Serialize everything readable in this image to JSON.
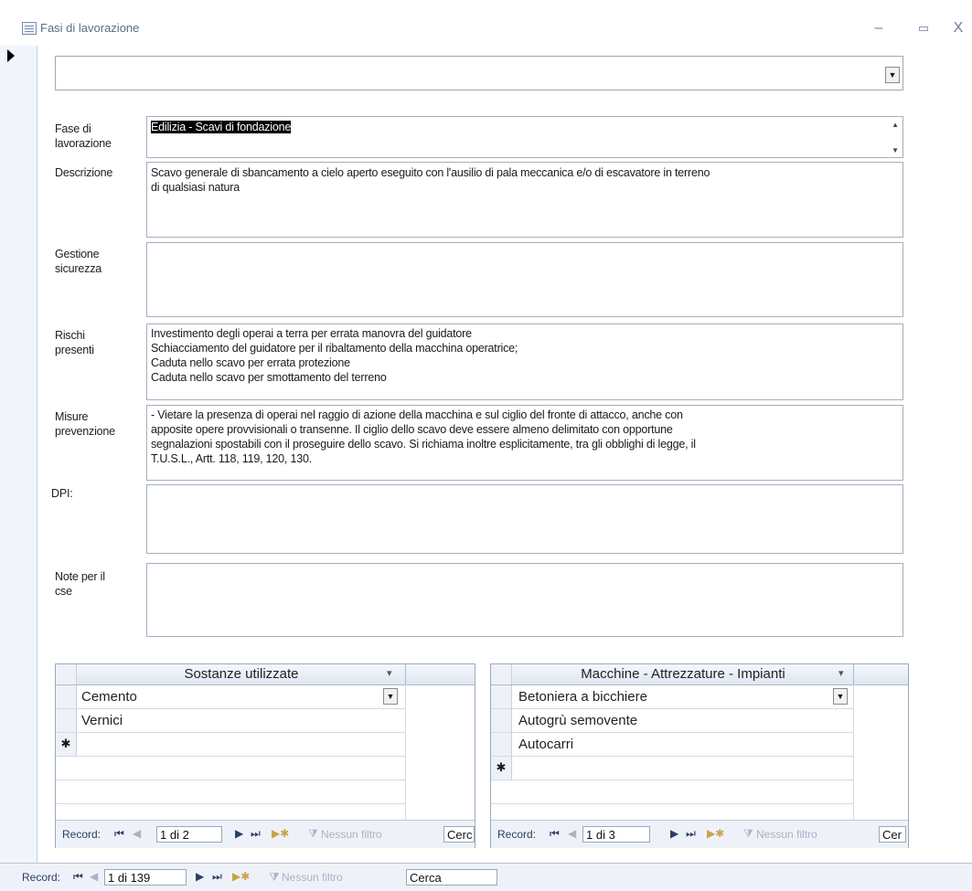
{
  "window": {
    "title": "Fasi di lavorazione",
    "minimize": "–",
    "maximize": "▭",
    "close": "X"
  },
  "record_selector": "▶",
  "fields": {
    "fase": {
      "label_1": "Fase di",
      "label_2": "lavorazione",
      "value": "Edilizia - Scavi di fondazione"
    },
    "descrizione": {
      "label": "Descrizione",
      "lines": [
        "Scavo generale di sbancamento a cielo aperto eseguito con l'ausilio di pala meccanica e/o di escavatore in terreno",
        "di qualsiasi natura"
      ]
    },
    "gestione": {
      "label_1": "Gestione",
      "label_2": "sicurezza"
    },
    "rischi": {
      "label_1": "Rischi",
      "label_2": "presenti",
      "lines": [
        "Investimento degli operai a terra per errata manovra del guidatore",
        "Schiacciamento del guidatore per il ribaltamento della macchina operatrice;",
        "Caduta nello scavo per errata protezione",
        "Caduta nello scavo per smottamento del terreno"
      ]
    },
    "misure": {
      "label_1": "Misure",
      "label_2": "prevenzione",
      "lines": [
        "- Vietare la presenza di operai nel raggio di azione della macchina e sul ciglio del fronte di attacco, anche con",
        "apposite opere provvisionali o transenne. Il ciglio dello scavo deve essere almeno delimitato con opportune",
        "segnalazioni spostabili con il proseguire dello scavo. Si richiama inoltre esplicitamente, tra gli obblighi di legge, il",
        "T.U.S.L., Artt. 118, 119, 120, 130."
      ]
    },
    "dpi": {
      "label": "DPI:"
    },
    "note": {
      "label_1": "Note per il",
      "label_2": "cse"
    }
  },
  "sostanze": {
    "header": "Sostanze utilizzate",
    "rows": [
      "Cemento",
      "Vernici"
    ],
    "new_marker": "✱",
    "nav": {
      "record": "Record:",
      "position": "1 di 2",
      "filter": "Nessun filtro",
      "search": "Cerc"
    }
  },
  "macchine": {
    "header": "Macchine - Attrezzature - Impianti",
    "rows": [
      "Betoniera a bicchiere",
      "Autogrù semovente",
      "Autocarri"
    ],
    "new_marker": "✱",
    "nav": {
      "record": "Record:",
      "position": "1 di 3",
      "filter": "Nessun filtro",
      "search": "Cer"
    }
  },
  "main_nav": {
    "record": "Record:",
    "position": "1 di 139",
    "filter": "Nessun filtro",
    "search": "Cerca"
  },
  "glyphs": {
    "dropdown": "▼",
    "first": "⏮",
    "prev": "◀",
    "next": "▶",
    "last": "⏭",
    "new": "▶✱",
    "filter_icon": "⧩",
    "sort": "▾",
    "spin_up": "▲",
    "spin_down": "▼"
  }
}
